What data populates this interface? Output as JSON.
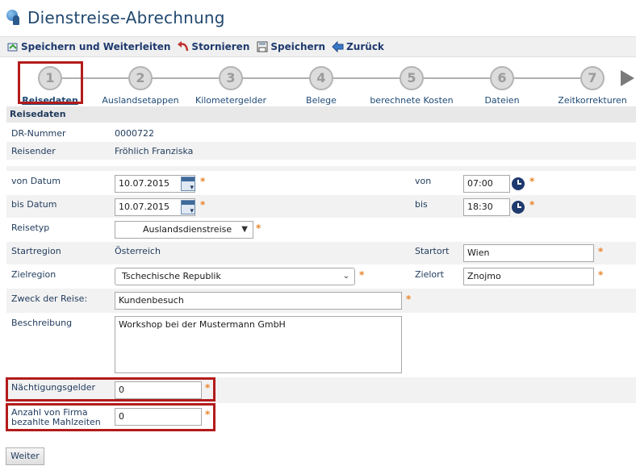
{
  "header": {
    "title": "Dienstreise-Abrechnung",
    "icon": "travel-globe-person-icon"
  },
  "toolbar": {
    "save_forward": "Speichern und Weiterleiten",
    "cancel": "Stornieren",
    "save": "Speichern",
    "back": "Zurück"
  },
  "steps": [
    {
      "number": "1",
      "label": "Reisedaten"
    },
    {
      "number": "2",
      "label": "Auslandsetappen"
    },
    {
      "number": "3",
      "label": "Kilometergelder"
    },
    {
      "number": "4",
      "label": "Belege"
    },
    {
      "number": "5",
      "label": "berechnete Kosten"
    },
    {
      "number": "6",
      "label": "Dateien"
    },
    {
      "number": "7",
      "label": "Zeitkorrekturen"
    }
  ],
  "section": {
    "title": "Reisedaten"
  },
  "form": {
    "dr_nummer_label": "DR-Nummer",
    "dr_nummer": "0000722",
    "reisender_label": "Reisender",
    "reisender": "Fröhlich Franziska",
    "von_datum_label": "von Datum",
    "von_datum": "10.07.2015",
    "von_label": "von",
    "von_time": "07:00",
    "bis_datum_label": "bis Datum",
    "bis_datum": "10.07.2015",
    "bis_label": "bis",
    "bis_time": "18:30",
    "reisetyp_label": "Reisetyp",
    "reisetyp": "Auslandsdienstreise",
    "startregion_label": "Startregion",
    "startregion": "Österreich",
    "startort_label": "Startort",
    "startort": "Wien",
    "zielregion_label": "Zielregion",
    "zielregion": "Tschechische Republik",
    "zielort_label": "Zielort",
    "zielort": "Znojmo",
    "zweck_label": "Zweck der Reise:",
    "zweck": "Kundenbesuch",
    "beschreibung_label": "Beschreibung",
    "beschreibung": "Workshop bei der Mustermann GmbH",
    "naechtigung_label": "Nächtigungsgelder",
    "naechtigung": "0",
    "mahlzeiten_label_1": "Anzahl von Firma",
    "mahlzeiten_label_2": "bezahlte Mahlzeiten",
    "mahlzeiten": "0",
    "required_mark": "*"
  },
  "footer": {
    "weiter": "Weiter"
  }
}
